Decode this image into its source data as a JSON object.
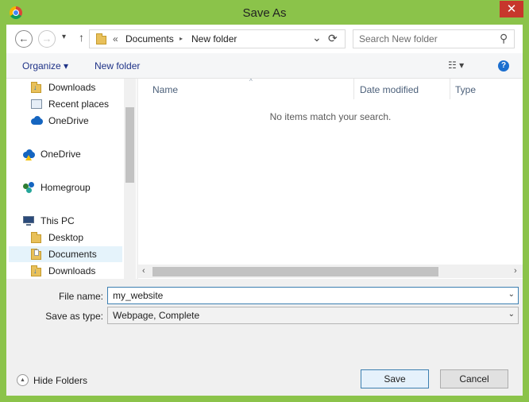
{
  "window": {
    "title": "Save As",
    "close_glyph": "✕",
    "app_icon": "chrome-icon"
  },
  "address": {
    "back_glyph": "←",
    "forward_glyph": "→",
    "recent_glyph": "▾",
    "up_glyph": "↑",
    "overflow": "«",
    "crumbs": [
      "Documents",
      "New folder"
    ],
    "crumb_sep": "▸",
    "dropdown_glyph": "⌄",
    "refresh_glyph": "⟳"
  },
  "search": {
    "placeholder": "Search New folder",
    "value": "",
    "icon_glyph": "⚲"
  },
  "toolbar": {
    "organize": "Organize ▾",
    "new_folder": "New folder",
    "view_glyph": "☷ ▾",
    "help_glyph": "?"
  },
  "nav": {
    "items": [
      {
        "label": "Downloads",
        "icon": "downloads-folder-icon"
      },
      {
        "label": "Recent places",
        "icon": "recent-places-icon"
      },
      {
        "label": "OneDrive",
        "icon": "onedrive-icon"
      },
      {
        "label": "OneDrive",
        "icon": "onedrive-warning-icon"
      },
      {
        "label": "Homegroup",
        "icon": "homegroup-icon"
      },
      {
        "label": "This PC",
        "icon": "computer-icon"
      },
      {
        "label": "Desktop",
        "icon": "folder-icon"
      },
      {
        "label": "Documents",
        "icon": "documents-folder-icon"
      },
      {
        "label": "Downloads",
        "icon": "downloads-folder-icon"
      }
    ],
    "selected_index": 7
  },
  "files": {
    "columns": [
      "Name",
      "Date modified",
      "Type"
    ],
    "sort_glyph": "^",
    "empty_message": "No items match your search.",
    "scroll_left": "‹",
    "scroll_right": "›"
  },
  "form": {
    "filename_label": "File name:",
    "filename_value": "my_website",
    "type_label": "Save as type:",
    "type_value": "Webpage, Complete",
    "dropdown_glyph": "⌄"
  },
  "footer": {
    "hide_folders": "Hide Folders",
    "hide_glyph": "▲",
    "save": "Save",
    "cancel": "Cancel"
  },
  "colors": {
    "border": "#8bc34a",
    "close": "#c7372c",
    "link": "#1e3287",
    "selection": "#e5f3fb",
    "focus": "#3c7fb1"
  }
}
